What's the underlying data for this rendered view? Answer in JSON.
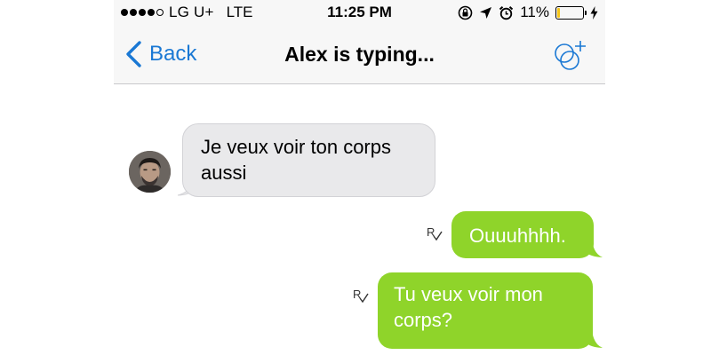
{
  "status_bar": {
    "carrier": "LG U+",
    "network": "LTE",
    "time": "11:25 PM",
    "battery_percent": "11%",
    "battery_level": 0.11,
    "battery_color": "#f5c518",
    "icons": [
      "signal-dots-icon",
      "rotation-lock-icon",
      "location-arrow-icon",
      "alarm-clock-icon",
      "battery-icon",
      "charging-bolt-icon"
    ]
  },
  "nav": {
    "back_label": "Back",
    "title": "Alex is typing...",
    "icons": [
      "back-chevron-icon",
      "add-participant-icon"
    ]
  },
  "colors": {
    "accent": "#1a78d4",
    "outgoing_bubble": "#8fd42a",
    "incoming_bubble": "#e9e9eb"
  },
  "messages": [
    {
      "direction": "incoming",
      "text": "Je veux voir ton corps aussi"
    },
    {
      "direction": "outgoing",
      "text": "Ouuuhhhh.",
      "read_receipt": "R"
    },
    {
      "direction": "outgoing",
      "text": "Tu veux voir mon corps?",
      "read_receipt": "R"
    }
  ]
}
